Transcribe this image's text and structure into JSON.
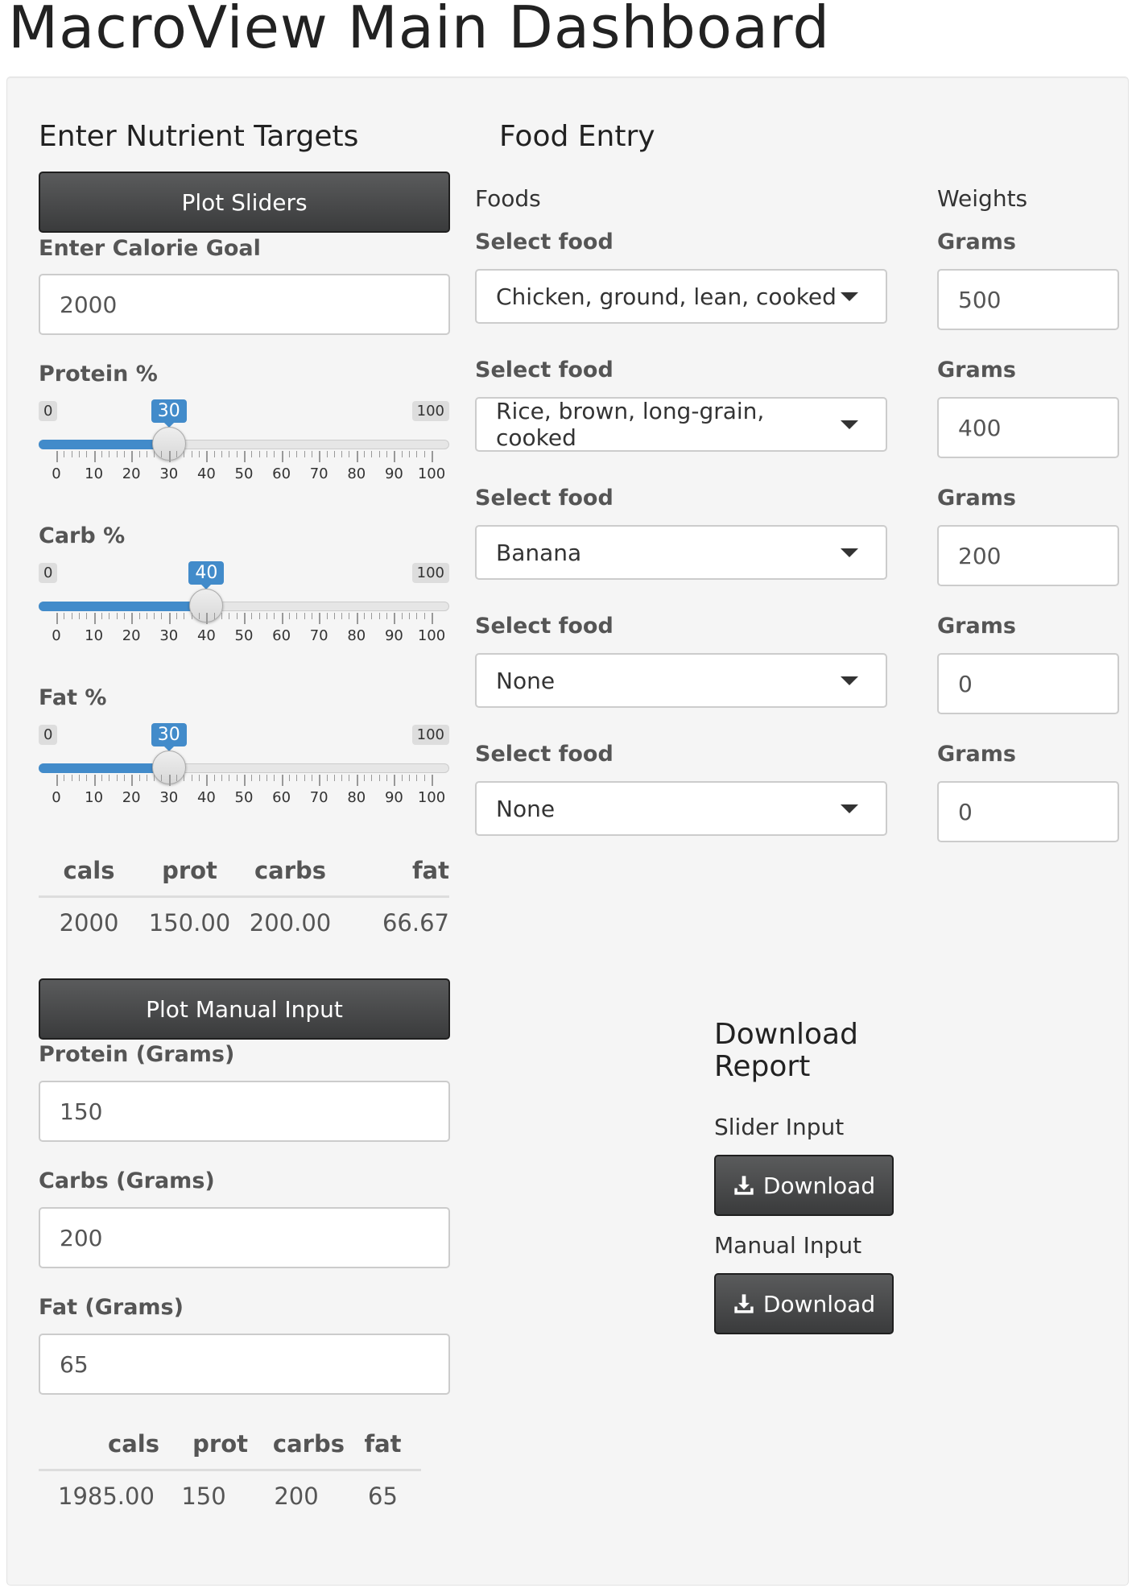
{
  "page": {
    "title": "MacroView Main Dashboard"
  },
  "targets": {
    "heading": "Enter Nutrient Targets",
    "plot_sliders_label": "Plot Sliders",
    "calorie_label": "Enter Calorie Goal",
    "calorie_value": "2000",
    "sliders": [
      {
        "label": "Protein %",
        "min": 0,
        "max": 100,
        "value": 30,
        "min_label": "0",
        "max_label": "100",
        "value_label": "30"
      },
      {
        "label": "Carb %",
        "min": 0,
        "max": 100,
        "value": 40,
        "min_label": "0",
        "max_label": "100",
        "value_label": "40"
      },
      {
        "label": "Fat %",
        "min": 0,
        "max": 100,
        "value": 30,
        "min_label": "0",
        "max_label": "100",
        "value_label": "30"
      }
    ],
    "tick_labels": [
      "0",
      "10",
      "20",
      "30",
      "40",
      "50",
      "60",
      "70",
      "80",
      "90",
      "100"
    ],
    "slider_table": {
      "headers": [
        "cals",
        "prot",
        "carbs",
        "fat"
      ],
      "row": [
        "2000",
        "150.00",
        "200.00",
        "66.67"
      ]
    },
    "plot_manual_label": "Plot Manual Input",
    "protein_label": "Protein (Grams)",
    "protein_value": "150",
    "carbs_label": "Carbs (Grams)",
    "carbs_value": "200",
    "fat_label": "Fat (Grams)",
    "fat_value": "65",
    "manual_table": {
      "headers": [
        "cals",
        "prot",
        "carbs",
        "fat"
      ],
      "row": [
        "1985.00",
        "150",
        "200",
        "65"
      ]
    }
  },
  "food_entry": {
    "heading": "Food Entry",
    "foods_label": "Foods",
    "weights_label": "Weights",
    "select_label": "Select food",
    "grams_label": "Grams",
    "rows": [
      {
        "food": "Chicken, ground, lean, cooked",
        "grams": "500"
      },
      {
        "food": "Rice, brown, long-grain, cooked",
        "grams": "400"
      },
      {
        "food": "Banana",
        "grams": "200"
      },
      {
        "food": "None",
        "grams": "0"
      },
      {
        "food": "None",
        "grams": "0"
      }
    ]
  },
  "download": {
    "heading": "Download Report",
    "slider_input_label": "Slider Input",
    "manual_input_label": "Manual Input",
    "button_label": "Download",
    "icon": "download-icon"
  },
  "colors": {
    "accent": "#428bca",
    "button_dark": "#3a3b3c",
    "panel_bg": "#f5f5f5"
  }
}
